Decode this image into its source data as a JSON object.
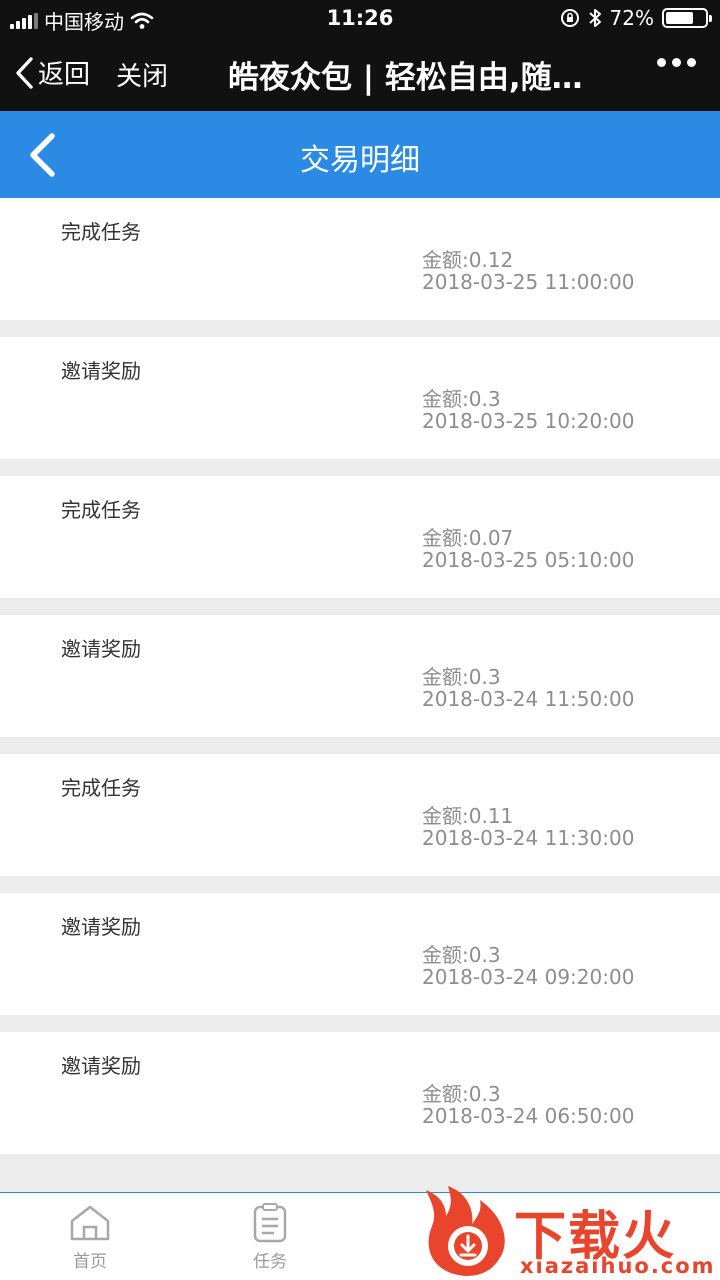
{
  "status_bar": {
    "carrier": "中国移动",
    "time": "11:26",
    "battery": "72%",
    "battery_level": 0.72
  },
  "wechat_nav": {
    "back_label": "返回",
    "close_label": "关闭",
    "title": "皓夜众包 | 轻松自由,随…"
  },
  "header": {
    "title": "交易明细"
  },
  "records": [
    {
      "type": "完成任务",
      "amount": "金额:0.12",
      "time": "2018-03-25 11:00:00"
    },
    {
      "type": "邀请奖励",
      "amount": "金额:0.3",
      "time": "2018-03-25 10:20:00"
    },
    {
      "type": "完成任务",
      "amount": "金额:0.07",
      "time": "2018-03-25 05:10:00"
    },
    {
      "type": "邀请奖励",
      "amount": "金额:0.3",
      "time": "2018-03-24 11:50:00"
    },
    {
      "type": "完成任务",
      "amount": "金额:0.11",
      "time": "2018-03-24 11:30:00"
    },
    {
      "type": "邀请奖励",
      "amount": "金额:0.3",
      "time": "2018-03-24 09:20:00"
    },
    {
      "type": "邀请奖励",
      "amount": "金额:0.3",
      "time": "2018-03-24 06:50:00"
    }
  ],
  "tabbar": {
    "tabs": [
      {
        "label": "首页",
        "icon": "home-icon"
      },
      {
        "label": "任务",
        "icon": "clipboard-icon"
      }
    ]
  },
  "watermark": {
    "brand": "下载火",
    "url": "xiazaihuo.com"
  },
  "colors": {
    "top_bar": "#111111",
    "header_blue": "#2b8ae4",
    "watermark_red": "#e8452c"
  }
}
